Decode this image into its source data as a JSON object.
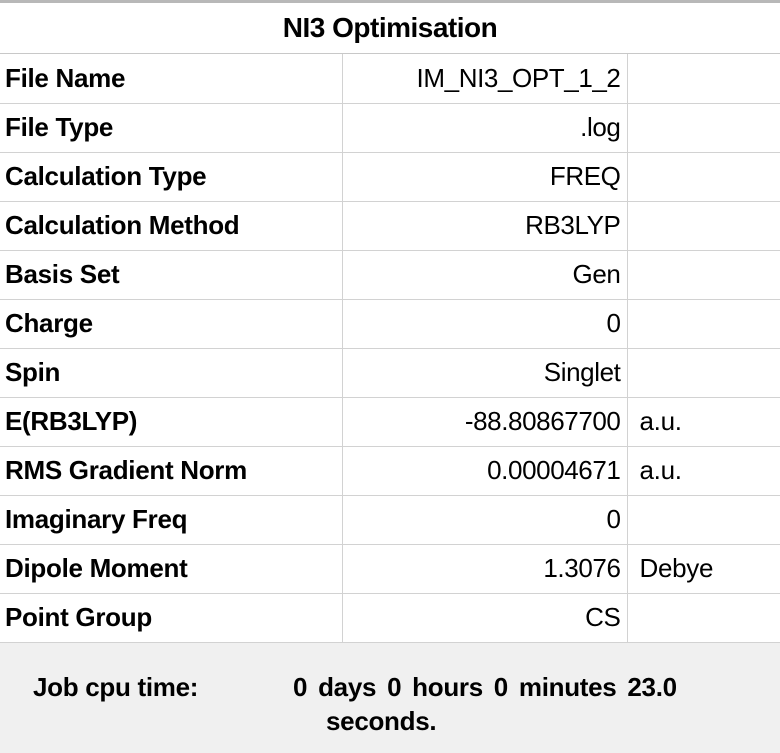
{
  "window": {
    "title": "NI3 Optimisation"
  },
  "rows": [
    {
      "label": "File Name",
      "value": "IM_NI3_OPT_1_2",
      "unit": ""
    },
    {
      "label": "File Type",
      "value": ".log",
      "unit": ""
    },
    {
      "label": "Calculation Type",
      "value": "FREQ",
      "unit": ""
    },
    {
      "label": "Calculation Method",
      "value": "RB3LYP",
      "unit": ""
    },
    {
      "label": "Basis Set",
      "value": "Gen",
      "unit": ""
    },
    {
      "label": "Charge",
      "value": "0",
      "unit": ""
    },
    {
      "label": "Spin",
      "value": "Singlet",
      "unit": ""
    },
    {
      "label": "E(RB3LYP)",
      "value": "-88.80867700",
      "unit": "a.u."
    },
    {
      "label": "RMS Gradient Norm",
      "value": "0.00004671",
      "unit": "a.u."
    },
    {
      "label": "Imaginary Freq",
      "value": "0",
      "unit": ""
    },
    {
      "label": "Dipole Moment",
      "value": "1.3076",
      "unit": "Debye"
    },
    {
      "label": "Point Group",
      "value": "CS",
      "unit": ""
    }
  ],
  "footer": {
    "label": "Job cpu time:",
    "value_line1": "0 days  0 hours  0 minutes 23.0",
    "value_line2": "seconds."
  }
}
